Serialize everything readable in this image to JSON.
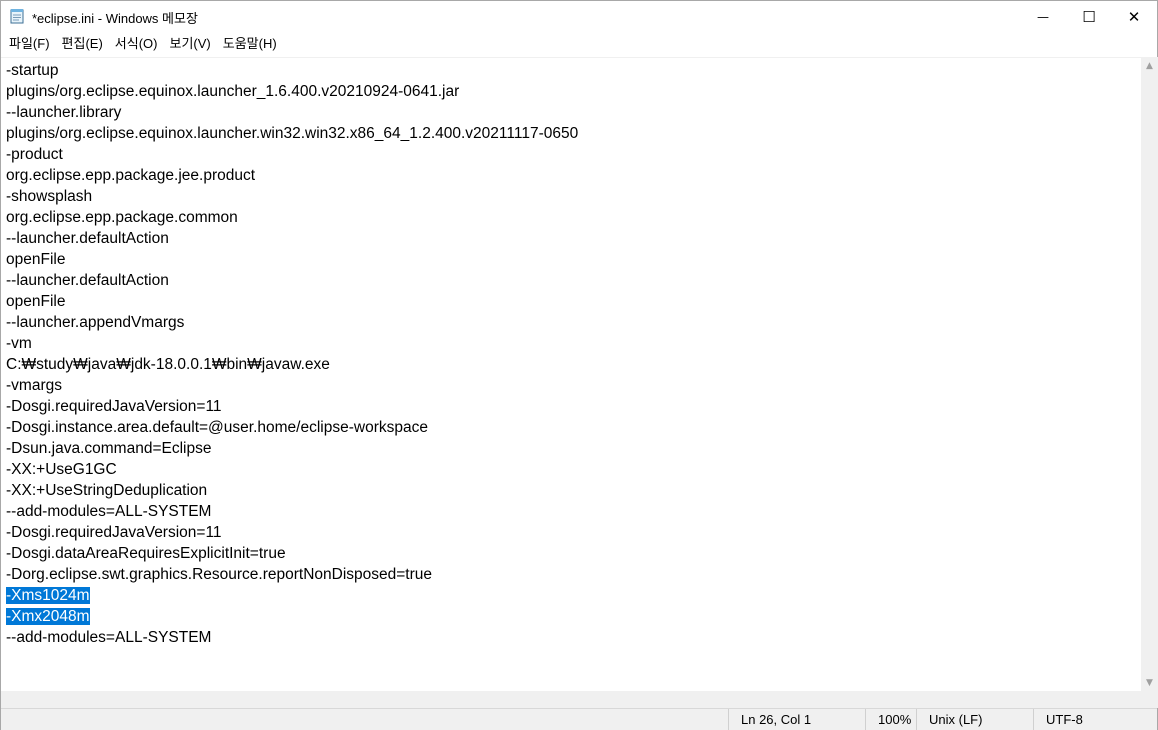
{
  "window": {
    "title": "*eclipse.ini - Windows 메모장",
    "icon": "notepad-icon",
    "controls": {
      "minimize": "—",
      "maximize": "☐",
      "close": "✕"
    }
  },
  "menu": [
    {
      "label": "파일(F)"
    },
    {
      "label": "편집(E)"
    },
    {
      "label": "서식(O)"
    },
    {
      "label": "보기(V)"
    },
    {
      "label": "도움말(H)"
    }
  ],
  "editor": {
    "lines": [
      {
        "text": "-startup",
        "selected": false
      },
      {
        "text": "plugins/org.eclipse.equinox.launcher_1.6.400.v20210924-0641.jar",
        "selected": false
      },
      {
        "text": "--launcher.library",
        "selected": false
      },
      {
        "text": "plugins/org.eclipse.equinox.launcher.win32.win32.x86_64_1.2.400.v20211117-0650",
        "selected": false
      },
      {
        "text": "-product",
        "selected": false
      },
      {
        "text": "org.eclipse.epp.package.jee.product",
        "selected": false
      },
      {
        "text": "-showsplash",
        "selected": false
      },
      {
        "text": "org.eclipse.epp.package.common",
        "selected": false
      },
      {
        "text": "--launcher.defaultAction",
        "selected": false
      },
      {
        "text": "openFile",
        "selected": false
      },
      {
        "text": "--launcher.defaultAction",
        "selected": false
      },
      {
        "text": "openFile",
        "selected": false
      },
      {
        "text": "--launcher.appendVmargs",
        "selected": false
      },
      {
        "text": "-vm",
        "selected": false
      },
      {
        "text": "C:₩study₩java₩jdk-18.0.0.1₩bin₩javaw.exe",
        "selected": false
      },
      {
        "text": "-vmargs",
        "selected": false
      },
      {
        "text": "-Dosgi.requiredJavaVersion=11",
        "selected": false
      },
      {
        "text": "-Dosgi.instance.area.default=@user.home/eclipse-workspace",
        "selected": false
      },
      {
        "text": "-Dsun.java.command=Eclipse",
        "selected": false
      },
      {
        "text": "-XX:+UseG1GC",
        "selected": false
      },
      {
        "text": "-XX:+UseStringDeduplication",
        "selected": false
      },
      {
        "text": "--add-modules=ALL-SYSTEM",
        "selected": false
      },
      {
        "text": "-Dosgi.requiredJavaVersion=11",
        "selected": false
      },
      {
        "text": "-Dosgi.dataAreaRequiresExplicitInit=true",
        "selected": false
      },
      {
        "text": "-Dorg.eclipse.swt.graphics.Resource.reportNonDisposed=true",
        "selected": false
      },
      {
        "text": "-Xms1024m",
        "selected": true
      },
      {
        "text": "-Xmx2048m",
        "selected": true
      },
      {
        "text": "--add-modules=ALL-SYSTEM",
        "selected": false
      }
    ],
    "selection_color": "#0078d7"
  },
  "scrollbar": {
    "up_arrow": "▲",
    "down_arrow": "▼"
  },
  "status": {
    "position": "Ln 26, Col 1",
    "zoom": "100%",
    "line_ending": "Unix (LF)",
    "encoding": "UTF-8"
  }
}
